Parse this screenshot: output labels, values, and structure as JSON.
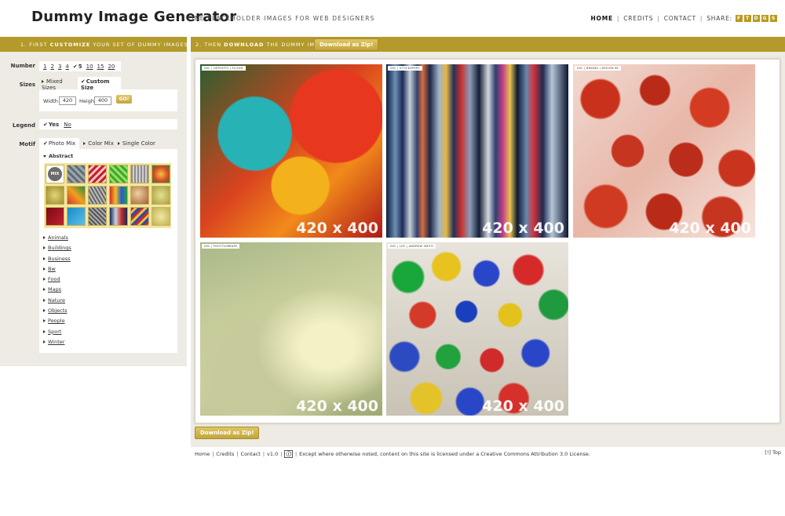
{
  "header": {
    "logo": "Dummy Image Generator",
    "tagline": "FINE PLACEHOLDER IMAGES FOR WEB DESIGNERS",
    "nav": [
      "HOME",
      "CREDITS",
      "CONTACT"
    ],
    "share_label": "SHARE:",
    "share_icons": [
      "facebook-icon",
      "twitter-icon",
      "delicious-icon",
      "digg-icon",
      "stumbleupon-icon"
    ]
  },
  "step1": {
    "prefix": "1. FIRST ",
    "bold": "CUSTOMIZE",
    "suffix": " YOUR SET OF DUMMY IMAGES HERE ..."
  },
  "step2": {
    "prefix": "2. THEN ",
    "bold": "DOWNLOAD",
    "suffix": " THE DUMMY IMAGES",
    "button": "Download as Zip!"
  },
  "sidebar": {
    "number_label": "Number",
    "numbers": [
      "1",
      "2",
      "3",
      "4",
      "5",
      "10",
      "15",
      "20"
    ],
    "selected_number": "5",
    "sizes_label": "Sizes",
    "size_modes": [
      "Mixed Sizes",
      "Custom Size"
    ],
    "width_label": "Width",
    "width_value": "420",
    "height_label": "Height",
    "height_value": "400",
    "go_button": "GO!",
    "legend_label": "Legend",
    "legend_yes": "Yes",
    "legend_no": "No",
    "motif_label": "Motif",
    "motif_modes": [
      "Photo Mix",
      "Color Mix",
      "Single Color"
    ],
    "category_title": "Abstract",
    "mix_badge": "MIX",
    "categories": [
      "Animals",
      "Buildings",
      "Business",
      "Bw",
      "Food",
      "Maps",
      "Nature",
      "Objects",
      "People",
      "Sport",
      "Winter"
    ]
  },
  "images": [
    {
      "credit": "SXC | GEPHOTO | FLICKR",
      "dim": "420 x 400"
    },
    {
      "credit": "SXC | STOCKXPERT",
      "dim": "420 x 400"
    },
    {
      "credit": "SXC | BRANDI | DESIGN BY",
      "dim": "420 x 400"
    },
    {
      "credit": "SXC | PHOTOLIBRARY",
      "dim": "420 x 400"
    },
    {
      "credit": "SXC | LEE | ANDREW SMITH",
      "dim": "420 x 400"
    }
  ],
  "bottom_button": "Download as Zip!",
  "footer": {
    "links": [
      "Home",
      "Credits",
      "Contact",
      "v1.0"
    ],
    "license": "Except where otherwise noted, content on this site is licensed under a Creative Commons Attribution 3.0 License.",
    "top": "[!] Top"
  }
}
